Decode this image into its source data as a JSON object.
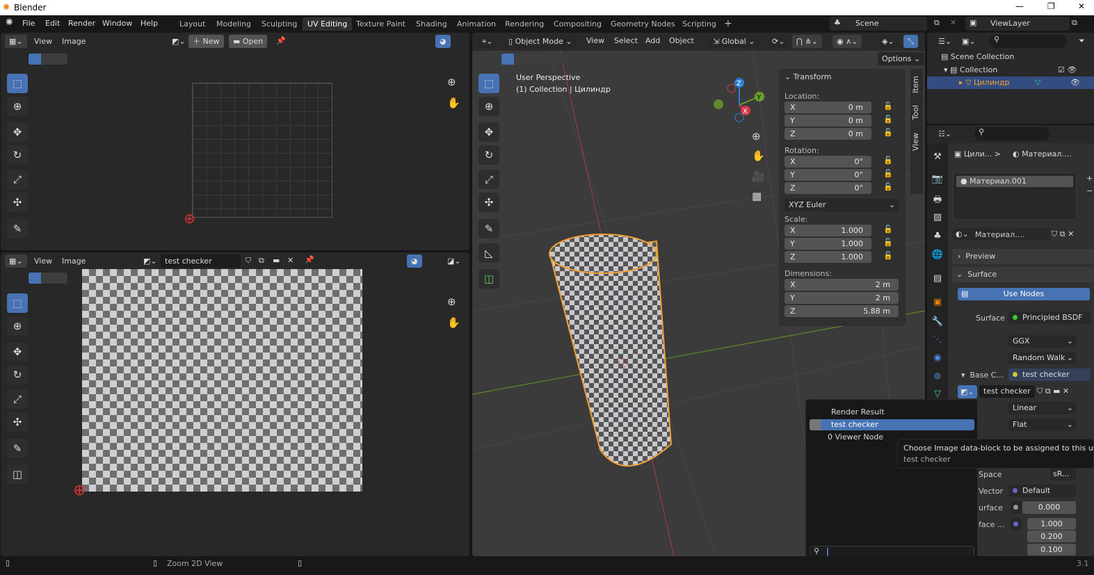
{
  "titlebar": {
    "title": "Blender",
    "minimize": "—",
    "maximize": "❐",
    "close": "✕"
  },
  "menu": [
    "File",
    "Edit",
    "Render",
    "Window",
    "Help"
  ],
  "workspaces": [
    "Layout",
    "Modeling",
    "Sculpting",
    "UV Editing",
    "Texture Paint",
    "Shading",
    "Animation",
    "Rendering",
    "Compositing",
    "Geometry Nodes",
    "Scripting",
    "+"
  ],
  "active_workspace": "UV Editing",
  "scene": {
    "name": "Scene",
    "view_layer": "ViewLayer"
  },
  "uv_top": {
    "menus": [
      "View",
      "Image"
    ],
    "new_label": "New",
    "open_label": "Open"
  },
  "uv_bottom": {
    "menus": [
      "View",
      "Image"
    ],
    "image_name": "test checker"
  },
  "viewport": {
    "mode": "Object Mode",
    "menus": [
      "View",
      "Select",
      "Add",
      "Object"
    ],
    "orientation": "Global",
    "options": "Options",
    "perspective": "User Perspective",
    "collection_info": "(1) Collection | Цилиндр",
    "tabs": [
      "Item",
      "Tool",
      "View"
    ]
  },
  "transform": {
    "title": "Transform",
    "location_label": "Location:",
    "location": [
      [
        "X",
        "0 m"
      ],
      [
        "Y",
        "0 m"
      ],
      [
        "Z",
        "0 m"
      ]
    ],
    "rotation_label": "Rotation:",
    "rotation": [
      [
        "X",
        "0°"
      ],
      [
        "Y",
        "0°"
      ],
      [
        "Z",
        "0°"
      ]
    ],
    "rotation_mode": "XYZ Euler",
    "scale_label": "Scale:",
    "scale": [
      [
        "X",
        "1.000"
      ],
      [
        "Y",
        "1.000"
      ],
      [
        "Z",
        "1.000"
      ]
    ],
    "dimensions_label": "Dimensions:",
    "dimensions": [
      [
        "X",
        "2 m"
      ],
      [
        "Y",
        "2 m"
      ],
      [
        "Z",
        "5.88 m"
      ]
    ]
  },
  "outliner": {
    "scene_collection": "Scene Collection",
    "collection": "Collection",
    "object": "Цилиндр"
  },
  "properties": {
    "breadcrumb_object": "Цили...",
    "breadcrumb_material": "Материал....",
    "slot": "Материал.001",
    "material_name": "Материал....",
    "preview": "Preview",
    "surface_panel": "Surface",
    "use_nodes": "Use Nodes",
    "surface_label": "Surface",
    "surface_value": "Principled BSDF",
    "distribution": "GGX",
    "subsurface_method": "Random Walk",
    "base_color_label": "Base C...",
    "base_color_value": "test checker",
    "image_name": "test checker",
    "interpolation": "Linear",
    "projection": "Flat",
    "color_space_label": "Space",
    "color_space": "sR...",
    "vector_label": "Vector",
    "vector_value": "Default",
    "subsurface_label": "urface",
    "subsurface_value": "0.000",
    "subsurface_radius_label": "face ...",
    "radius": [
      "1.000",
      "0.200",
      "0.100"
    ]
  },
  "image_dropdown": {
    "items": [
      "Render Result",
      "test checker",
      "0 Viewer Node"
    ],
    "selected": "test checker",
    "search_value": ""
  },
  "tooltip": {
    "text": "Choose Image data-block to be assigned to this user",
    "value": "test checker"
  },
  "statusbar": {
    "hint": "Zoom 2D View",
    "version": "3.1"
  },
  "colors": {
    "accent": "#4772b3",
    "selected_object": "#f0a030",
    "background": "#282828"
  }
}
